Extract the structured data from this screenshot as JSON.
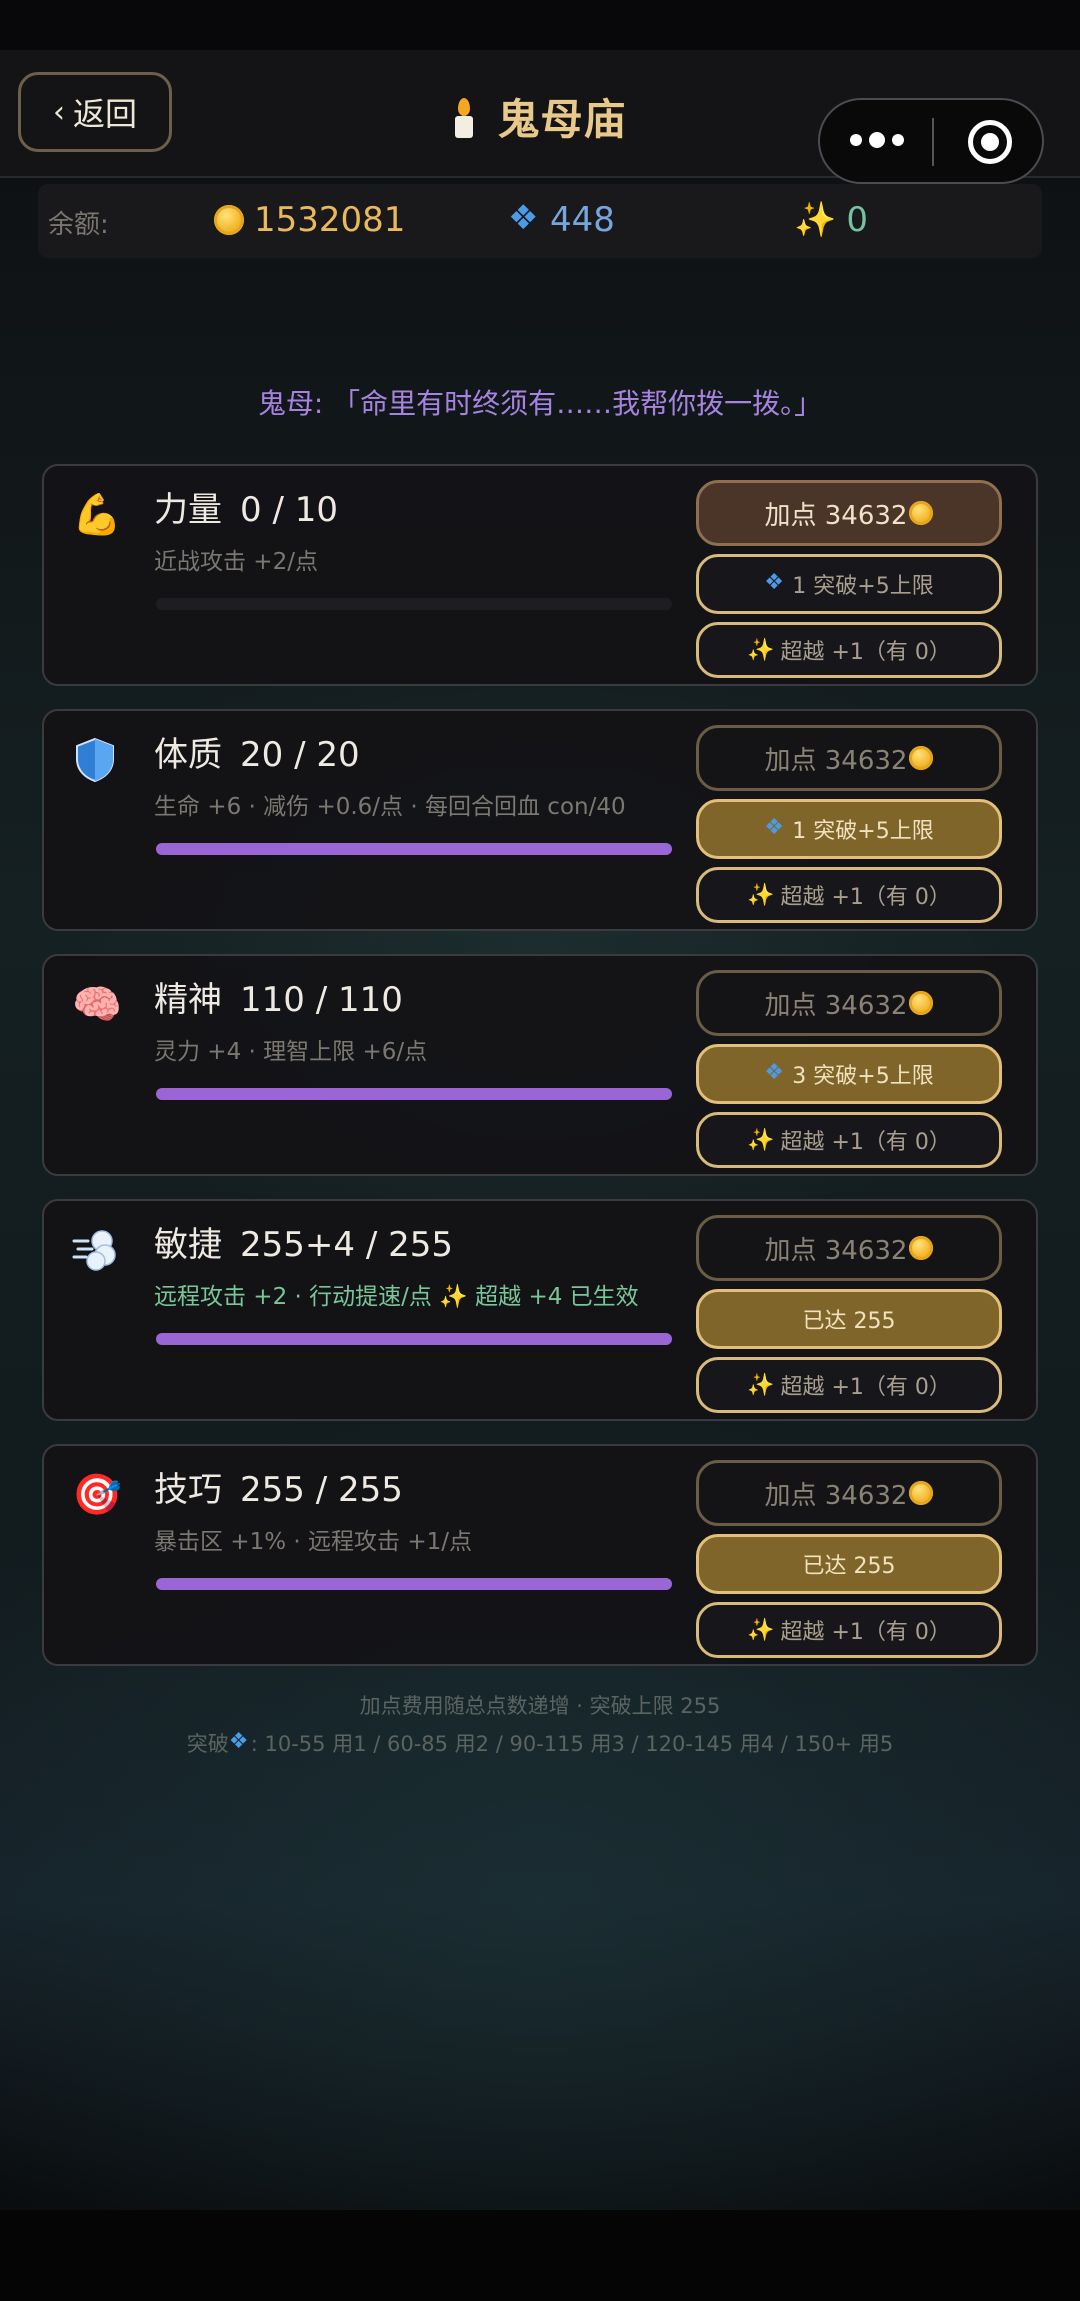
{
  "nav": {
    "back_label": "返回",
    "title": "鬼母庙"
  },
  "balance": {
    "label": "余额:",
    "coins": "1532081",
    "gems": "448",
    "stars": "0"
  },
  "dialogue": "鬼母: 「命里有时终须有……我帮你拨一拨。」",
  "stats": [
    {
      "name": "力量",
      "value": "0 / 10",
      "desc": "近战攻击 +2/点",
      "progress": 0.0,
      "add_label": "加点 34632",
      "break_label": "1 突破+5上限",
      "over_label": "超越 +1（有 0）"
    },
    {
      "name": "体质",
      "value": "20 / 20",
      "desc": "生命 +6 · 减伤 +0.6/点 · 每回合回血 con/40",
      "progress": 1.0,
      "add_label": "加点 34632",
      "break_label": "1 突破+5上限",
      "over_label": "超越 +1（有 0）"
    },
    {
      "name": "精神",
      "value": "110 / 110",
      "desc": "灵力 +4 · 理智上限 +6/点",
      "progress": 1.0,
      "add_label": "加点 34632",
      "break_label": "3 突破+5上限",
      "over_label": "超越 +1（有 0）"
    },
    {
      "name": "敏捷",
      "value": "255+4 / 255",
      "desc": "远程攻击 +2 · 行动提速/点 ✨ 超越 +4 已生效",
      "progress": 1.0,
      "add_label": "加点 34632",
      "break_label": "已达 255",
      "over_label": "超越 +1（有 0）"
    },
    {
      "name": "技巧",
      "value": "255 / 255",
      "desc": "暴击区 +1% · 远程攻击 +1/点",
      "progress": 1.0,
      "add_label": "加点 34632",
      "break_label": "已达 255",
      "over_label": "超越 +1（有 0）"
    }
  ],
  "footer": {
    "line1": "加点费用随总点数递增 · 突破上限 255",
    "line2_prefix": "突破",
    "line2_rest": ": 10-55 用1 / 60-85 用2 / 90-115 用3 / 120-145 用4 / 150+ 用5"
  },
  "icons": [
    "flexed-biceps-icon",
    "shield-icon",
    "brain-icon",
    "wind-icon",
    "target-icon"
  ]
}
